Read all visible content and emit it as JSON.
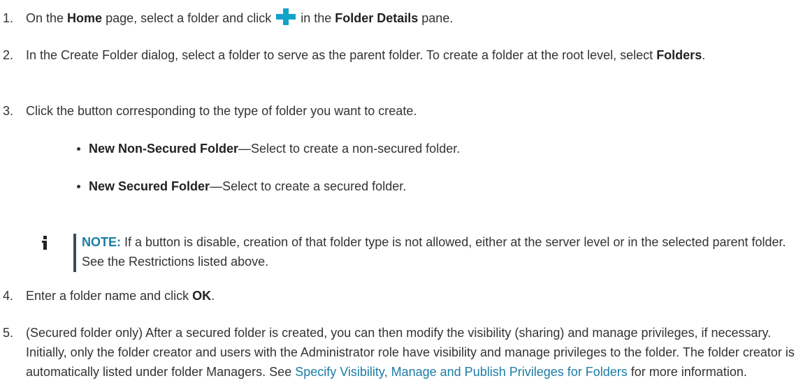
{
  "steps": [
    {
      "num": "1.",
      "a": "On the ",
      "b1": "Home",
      "c": " page, select a folder and click ",
      "d": " in the ",
      "b2": "Folder Details",
      "e": " pane."
    },
    {
      "num": "2.",
      "a": "In the Create Folder dialog, select a folder to serve as the parent folder. To create a folder at the root level, select ",
      "b1": "Folders",
      "c": "."
    },
    {
      "num": "3.",
      "a": "Click the button corresponding to the type of folder you want to create."
    },
    {
      "num": "4.",
      "a": "Enter a folder name and click ",
      "b1": "OK",
      "c": "."
    },
    {
      "num": "5.",
      "a": "(Secured folder only) After a secured folder is created, you can then modify the visibility (sharing) and manage privileges, if necessary. Initially, only the folder creator and users with the Administrator role have visibility and manage privileges to the folder. The folder creator is automatically listed under folder Managers. See ",
      "link": "Specify Visibility, Manage and Publish Privileges for Folders",
      "c": " for more information."
    }
  ],
  "bullets": [
    {
      "bold": "New Non-Secured Folder",
      "text": "—Select to create a non-secured folder."
    },
    {
      "bold": "New Secured Folder",
      "text": "—Select to create a secured folder."
    }
  ],
  "note": {
    "label": "NOTE:",
    "text": " If a button is disable, creation of that folder type is not allowed, either at the server level or in the selected parent folder. See the Restrictions listed above."
  },
  "icons": {
    "add": "plus-icon",
    "info": "info-icon"
  },
  "colors": {
    "accent": "#12a3c9",
    "link": "#1b7da6",
    "text": "#333333"
  }
}
